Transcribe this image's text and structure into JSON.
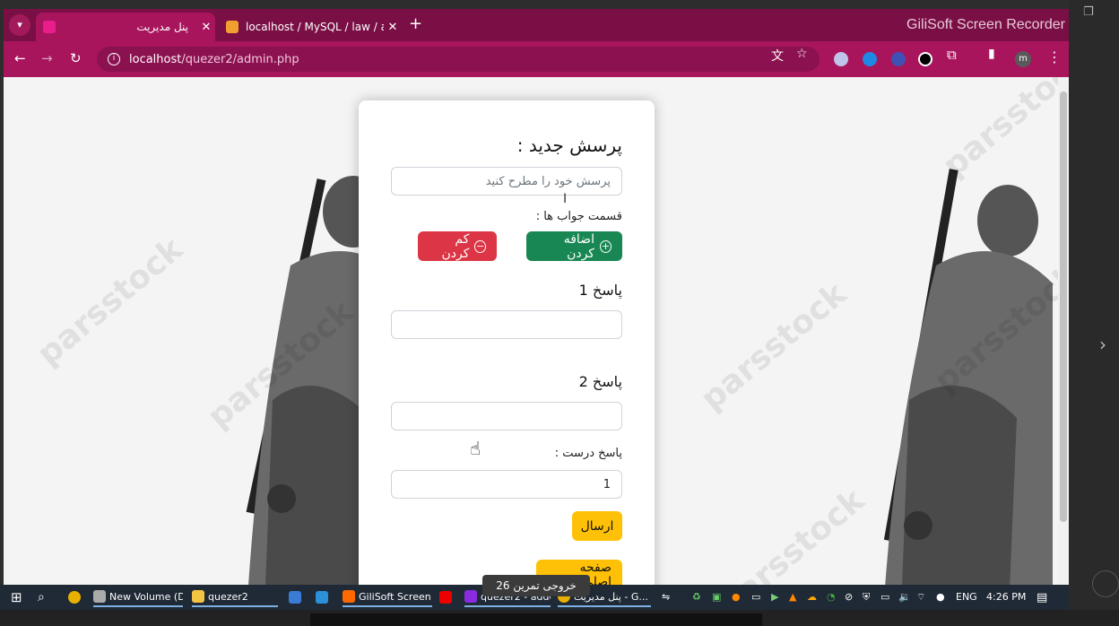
{
  "browser": {
    "tabs": [
      {
        "label": "پنل مدیریت",
        "favicon_color": "#e91e8c",
        "active": true
      },
      {
        "label": "localhost / MySQL / law / answ",
        "favicon_color": "#f0a030",
        "active": false
      }
    ],
    "new_tab_symbol": "+",
    "overlay_label": "GiliSoft Screen Recorder",
    "url_host": "localhost",
    "url_path": "/quezer2/admin.php",
    "profile_initial": "m",
    "accent": "#a8155d"
  },
  "form": {
    "title": "پرسش جدید :",
    "question_placeholder": "پرسش خود را مطرح کنید",
    "answers_section_label": "قسمت جواب ها :",
    "add_button": "اضافه کردن",
    "remove_button": "کم کردن",
    "answers": [
      {
        "label": "پاسخ 1",
        "value": ""
      },
      {
        "label": "پاسخ 2",
        "value": ""
      }
    ],
    "correct_answer_label": "پاسخ درست :",
    "correct_answer_value": "1",
    "submit_button": "ارسال",
    "home_button": "صفحه اصلی"
  },
  "watermark_text": "parsstock",
  "taskbar": {
    "items": [
      {
        "label": "New Volume (D:)"
      },
      {
        "label": "quezer2"
      },
      {
        "label": "GiliSoft Screen ..."
      },
      {
        "label": "quezer2 - adde..."
      },
      {
        "label": "پنل مدیریت - G..."
      }
    ],
    "tooltip": "خروجی تمرین 26",
    "language": "ENG",
    "time": "4:26 PM"
  }
}
